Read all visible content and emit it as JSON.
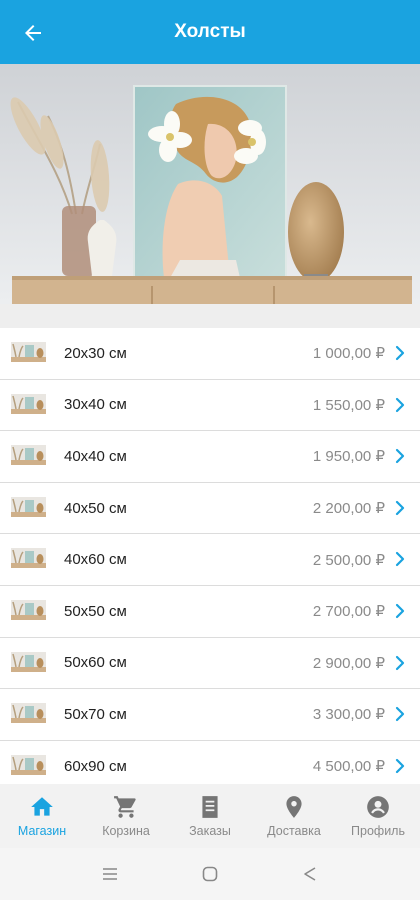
{
  "header": {
    "title": "Холсты"
  },
  "products": [
    {
      "size": "20x30 см",
      "price": "1 000,00 ₽"
    },
    {
      "size": "30x40 см",
      "price": "1 550,00 ₽"
    },
    {
      "size": "40x40 см",
      "price": "1 950,00 ₽"
    },
    {
      "size": "40x50 см",
      "price": "2 200,00 ₽"
    },
    {
      "size": "40x60 см",
      "price": "2 500,00 ₽"
    },
    {
      "size": "50x50 см",
      "price": "2 700,00 ₽"
    },
    {
      "size": "50x60 см",
      "price": "2 900,00 ₽"
    },
    {
      "size": "50x70 см",
      "price": "3 300,00 ₽"
    },
    {
      "size": "60x90 см",
      "price": "4 500,00 ₽"
    }
  ],
  "nav": {
    "active": "shop",
    "items": [
      {
        "label": "Магазин",
        "icon": "home-icon"
      },
      {
        "label": "Корзина",
        "icon": "cart-icon"
      },
      {
        "label": "Заказы",
        "icon": "orders-icon"
      },
      {
        "label": "Доставка",
        "icon": "location-pin-icon"
      },
      {
        "label": "Профиль",
        "icon": "profile-icon"
      }
    ]
  },
  "colors": {
    "accent": "#1aa3e0",
    "price": "#8a8a8a",
    "nav_inactive": "#8a8a8a"
  }
}
